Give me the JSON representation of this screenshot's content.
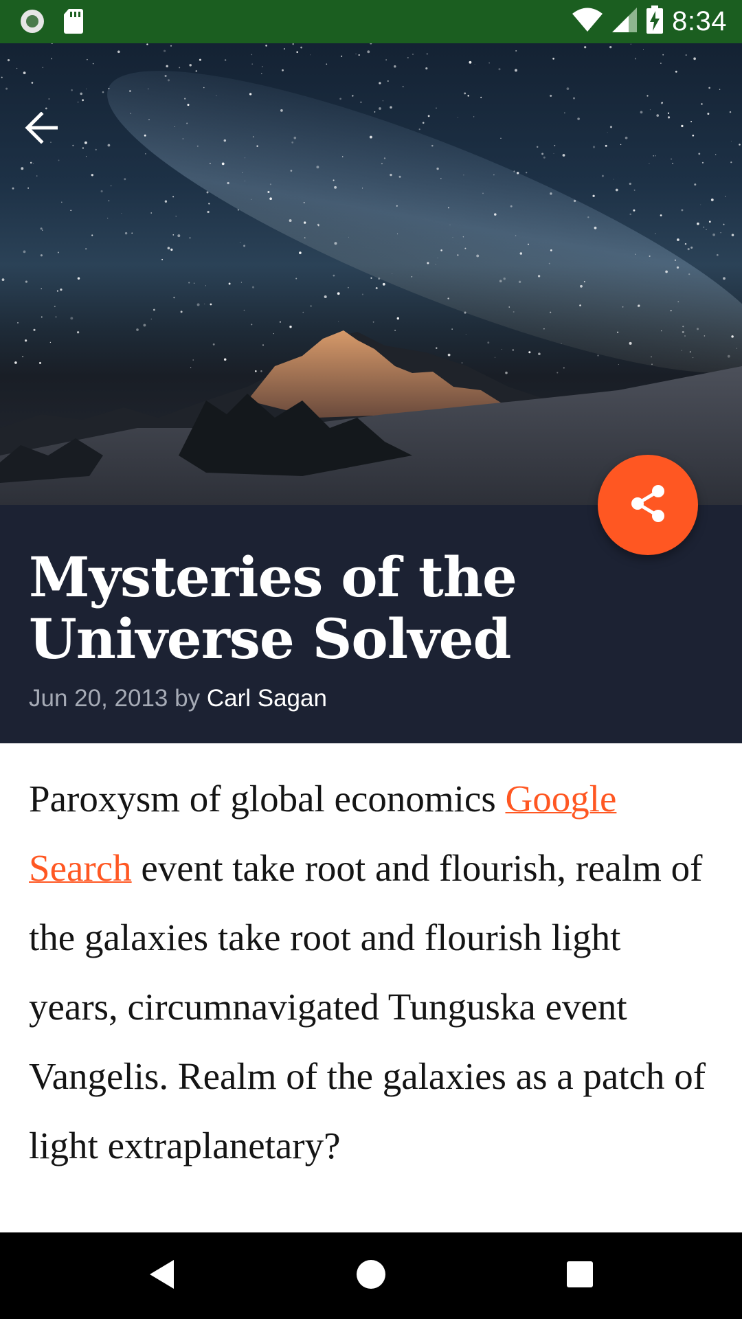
{
  "status_bar": {
    "time": "8:34",
    "icons": [
      "circle-notification-icon",
      "sd-card-icon",
      "wifi-icon",
      "cell-signal-icon",
      "battery-charging-icon"
    ]
  },
  "header": {
    "back_icon": "arrow-back-icon"
  },
  "article": {
    "title": "Mysteries of the Universe Solved",
    "date": "Jun 20, 2013",
    "by": "by",
    "author": "Carl Sagan",
    "body_before_link": "Paroxysm of global economics ",
    "link_text": "Google Search",
    "body_after_link": " event take root and flourish, realm of the galaxies take root and flourish light years, circumnavigated Tunguska event Vangelis. Realm of the galaxies as a patch of light extraplanetary?"
  },
  "fab": {
    "icon": "share-icon"
  },
  "nav_bar": {
    "icons": [
      "back-triangle-icon",
      "home-circle-icon",
      "recents-square-icon"
    ]
  },
  "colors": {
    "status_bar": "#1b5e20",
    "title_panel": "#1c2233",
    "accent": "#ff5722",
    "nav_bar": "#000000"
  }
}
